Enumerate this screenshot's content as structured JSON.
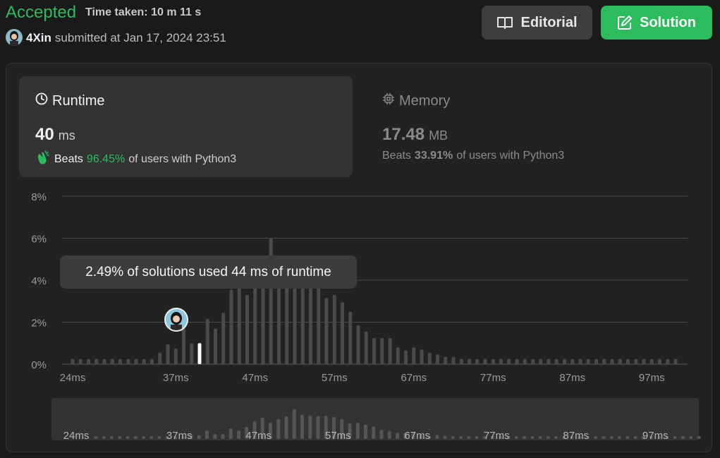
{
  "header": {
    "status": "Accepted",
    "time_taken": "Time taken: 10 m 11 s",
    "username": "4Xin",
    "submitted": "submitted at Jan 17, 2024 23:51",
    "editorial_label": "Editorial",
    "solution_label": "Solution"
  },
  "runtime": {
    "title": "Runtime",
    "value": "40",
    "unit": "ms",
    "beats_prefix": "Beats",
    "beats_pct": "96.45%",
    "beats_suffix": "of users with Python3"
  },
  "memory": {
    "title": "Memory",
    "value": "17.48",
    "unit": "MB",
    "beats_prefix": "Beats",
    "beats_pct": "33.91%",
    "beats_suffix": "of users with Python3"
  },
  "tooltip": "2.49% of solutions used 44 ms of runtime",
  "colors": {
    "accent_green": "#2cbb5d",
    "bar": "#4a4a4a",
    "selected_bar": "#ffffff"
  },
  "icons": {
    "editorial": "book-open-icon",
    "solution": "edit-icon",
    "runtime": "clock-icon",
    "memory": "chip-icon",
    "beats": "clap-icon"
  },
  "chart_data": {
    "type": "bar",
    "ylabel_ticks": [
      "0%",
      "2%",
      "4%",
      "6%",
      "8%"
    ],
    "ylim": [
      0,
      8
    ],
    "xlim": [
      23,
      100
    ],
    "x_ticks": [
      24,
      37,
      47,
      57,
      67,
      77,
      87,
      97
    ],
    "x_tick_labels": [
      "24ms",
      "37ms",
      "47ms",
      "57ms",
      "67ms",
      "77ms",
      "87ms",
      "97ms"
    ],
    "grid": true,
    "selected_x": 40,
    "x": [
      24,
      25,
      26,
      27,
      28,
      29,
      30,
      31,
      32,
      33,
      34,
      35,
      36,
      37,
      38,
      39,
      40,
      41,
      42,
      43,
      44,
      45,
      46,
      47,
      48,
      49,
      50,
      51,
      52,
      53,
      54,
      55,
      56,
      57,
      58,
      59,
      60,
      61,
      62,
      63,
      64,
      65,
      66,
      67,
      68,
      69,
      70,
      71,
      72,
      73,
      74,
      75,
      76,
      77,
      78,
      79,
      80,
      81,
      82,
      83,
      84,
      85,
      86,
      87,
      88,
      89,
      90,
      91,
      92,
      93,
      94,
      95,
      96,
      97,
      98,
      99,
      100
    ],
    "values": [
      0.25,
      0.25,
      0.25,
      0.25,
      0.25,
      0.25,
      0.25,
      0.25,
      0.25,
      0.25,
      0.25,
      0.55,
      0.95,
      0.75,
      1.7,
      1.0,
      1.0,
      2.15,
      1.7,
      2.45,
      3.55,
      4.3,
      3.3,
      4.0,
      4.6,
      6.0,
      4.9,
      4.7,
      4.6,
      4.7,
      4.45,
      4.05,
      3.15,
      3.3,
      2.95,
      2.5,
      1.85,
      1.55,
      1.25,
      1.25,
      1.25,
      0.8,
      0.65,
      0.8,
      0.7,
      0.55,
      0.45,
      0.35,
      0.35,
      0.25,
      0.25,
      0.25,
      0.25,
      0.25,
      0.25,
      0.25,
      0.25,
      0.25,
      0.25,
      0.25,
      0.25,
      0.25,
      0.25,
      0.25,
      0.25,
      0.25,
      0.25,
      0.25,
      0.25,
      0.25,
      0.25,
      0.25,
      0.25,
      0.25,
      0.25,
      0.25,
      0.25
    ]
  }
}
